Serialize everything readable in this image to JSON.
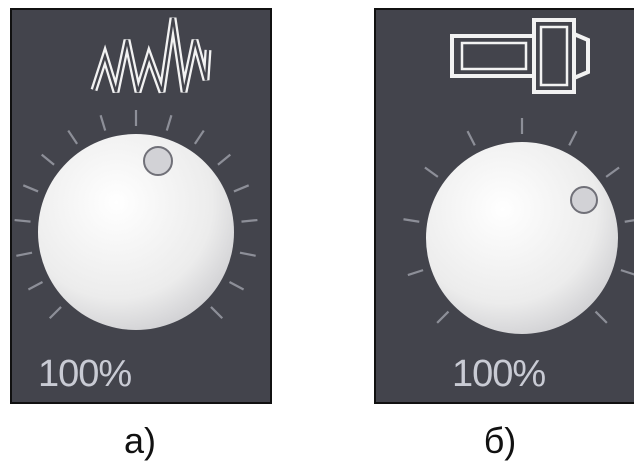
{
  "panels": [
    {
      "id": "a",
      "icon": "waveform-zigzag-icon",
      "knob_level_percent": 100,
      "value_label": "100%",
      "caption": "а)"
    },
    {
      "id": "b",
      "icon": "connector-plug-icon",
      "knob_level_percent": 100,
      "value_label": "100%",
      "caption": "б)"
    }
  ],
  "colors": {
    "panel_bg": "#43444c",
    "border": "#111111",
    "icon_stroke": "#f2f2f2",
    "tick": "#8d8f98",
    "knob": "#f1f1f1",
    "text": "#c9cbd4"
  }
}
